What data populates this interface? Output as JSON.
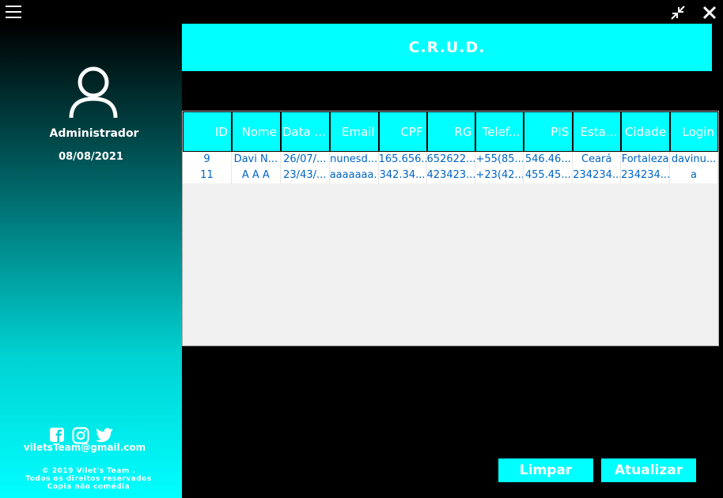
{
  "header": {
    "title": "C.R.U.D."
  },
  "user": {
    "name": "Administrador",
    "date": "08/08/2021"
  },
  "footer": {
    "email": "viletsTeam@gmail.com",
    "copyright": "© 2019 Vilet's Team .",
    "rights": "Todos os direitos reservados",
    "tagline": "Copia não comédia"
  },
  "icons": {
    "menu": "hamburger-menu-icon",
    "minimize": "compress-icon",
    "close": "close-icon",
    "avatar": "user-icon",
    "facebook": "facebook-icon",
    "instagram": "instagram-icon",
    "twitter": "twitter-icon"
  },
  "colors": {
    "accent": "#00ffff",
    "cell_text": "#0064c8",
    "grid_bg": "#f0f0f0"
  },
  "table": {
    "columns": [
      "ID",
      "Nome",
      "Data ...",
      "Email",
      "CPF",
      "RG",
      "Telef...",
      "PIS",
      "Esta...",
      "Cidade",
      "Login"
    ],
    "rows": [
      [
        "9",
        "Davi N...",
        "26/07/...",
        "nunesd...",
        "165.656...",
        "652622...",
        "+55(85...",
        "546.46...",
        "Ceará",
        "Fortaleza",
        "davinu..."
      ],
      [
        "11",
        "A A A",
        "23/43/...",
        "aaaaaaa...",
        "342.34...",
        "423423...",
        "+23(42...",
        "455.45...",
        "234234...",
        "234234...",
        "a"
      ]
    ]
  },
  "buttons": {
    "clear": "Limpar",
    "refresh": "Atualizar"
  }
}
